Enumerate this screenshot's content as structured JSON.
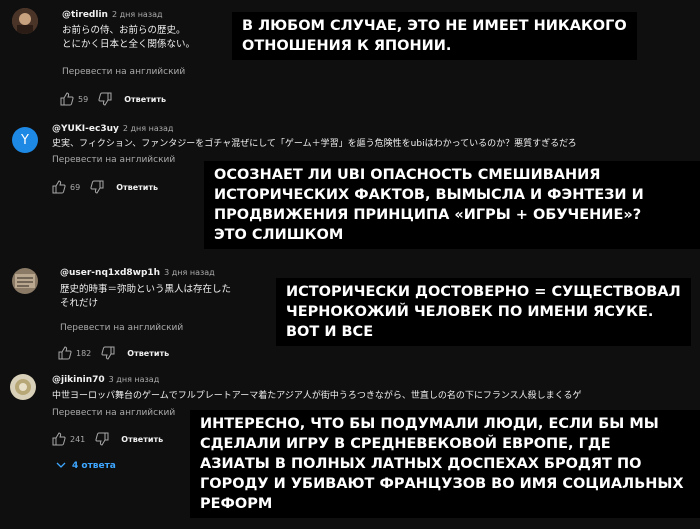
{
  "comments": [
    {
      "handle": "@tiredlin",
      "time": "2 дня назад",
      "lines": [
        "お前らの侍、お前らの歴史。",
        "とにかく日本と全く関係ない。"
      ],
      "translate": "Перевести на английский",
      "likes": "59",
      "reply": "Ответить",
      "caption": [
        "В любом случае, это не имеет никакого",
        "отношения к Японии."
      ]
    },
    {
      "handle": "@YUKI-ec3uy",
      "time": "2 дня назад",
      "lines": [
        "史実、フィクション、ファンタジーをゴチャ混ぜにして「ゲーム＋学習」を謳う危険性をubiはわかっているのか？悪質すぎるだろ"
      ],
      "translate": "Перевести на английский",
      "likes": "69",
      "reply": "Ответить",
      "avatar_letter": "Y",
      "caption": [
        "Осознает ли Ubi опасность смешивания",
        "исторических фактов, вымысла и фэнтези и",
        "продвижения принципа «игры + обучение»?",
        "Это слишком"
      ]
    },
    {
      "handle": "@user-nq1xd8wp1h",
      "time": "3 дня назад",
      "lines": [
        "歴史的時事＝弥助という黒人は存在した",
        "それだけ"
      ],
      "translate": "Перевести на английский",
      "likes": "182",
      "reply": "Ответить",
      "caption": [
        "Исторически достоверно = существовал",
        "чернокожий человек по имени Ясуке.",
        "Вот и все"
      ]
    },
    {
      "handle": "@jikinin70",
      "time": "3 дня назад",
      "lines": [
        "中世ヨーロッパ舞台のゲームでフルプレートアーマ着たアジア人が街中うろつきながら、世直しの名の下にフランス人殺しまくるゲ"
      ],
      "translate": "Перевести на английский",
      "likes": "241",
      "reply": "Ответить",
      "replies": "4 ответа",
      "caption": [
        "Интересно, что бы подумали люди, если бы мы",
        "сделали игру в средневековой Европе, где",
        "азиаты в полных латных доспехах бродят по",
        "городу и убивают французов во имя социальных",
        "реформ"
      ]
    }
  ],
  "icons": [
    "thumb-up-icon",
    "thumb-down-icon",
    "chevron-down-icon"
  ],
  "colors": {
    "background": "#0f0f0f",
    "caption_bg": "#000000",
    "link": "#3ea6ff",
    "muted": "#aaaaaa",
    "avatar_y": "#1e88e5"
  }
}
